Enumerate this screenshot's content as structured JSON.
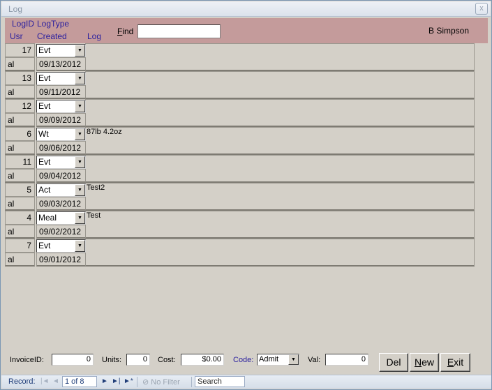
{
  "window": {
    "title": "Log",
    "close": "x"
  },
  "header": {
    "col_logid": "LogID",
    "col_logtype": "LogType",
    "col_usr": "Usr",
    "col_created": "Created",
    "col_log": "Log",
    "find_label_accel": "F",
    "find_label_rest": "ind",
    "find_value": "",
    "user_name": "B Simpson"
  },
  "records": [
    {
      "id": "17",
      "type": "Evt",
      "log": "",
      "usr": "al",
      "created": "09/13/2012"
    },
    {
      "id": "13",
      "type": "Evt",
      "log": "",
      "usr": "al",
      "created": "09/11/2012"
    },
    {
      "id": "12",
      "type": "Evt",
      "log": "",
      "usr": "al",
      "created": "09/09/2012"
    },
    {
      "id": "6",
      "type": "Wt",
      "log": "87lb 4.2oz",
      "usr": "al",
      "created": "09/06/2012"
    },
    {
      "id": "11",
      "type": "Evt",
      "log": "",
      "usr": "al",
      "created": "09/04/2012"
    },
    {
      "id": "5",
      "type": "Act",
      "log": "Test2",
      "usr": "al",
      "created": "09/03/2012"
    },
    {
      "id": "4",
      "type": "Meal",
      "log": "Test",
      "usr": "al",
      "created": "09/02/2012"
    },
    {
      "id": "7",
      "type": "Evt",
      "log": "",
      "usr": "al",
      "created": "09/01/2012"
    }
  ],
  "footer": {
    "invoice_label": "InvoiceID:",
    "invoice_value": "0",
    "units_label": "Units:",
    "units_value": "0",
    "cost_label": "Cost:",
    "cost_value": "$0.00",
    "code_label": "Code:",
    "code_value": "Admit",
    "val_label": "Val:",
    "val_value": "0",
    "del_label": "Del",
    "new_accel": "N",
    "new_rest": "ew",
    "exit_accel": "E",
    "exit_rest": "xit"
  },
  "statusbar": {
    "record_label": "Record:",
    "record_position": "1 of 8",
    "filter_label": "No Filter",
    "search_label": "Search"
  },
  "icons": {
    "dropdown": "dropdown-arrow-icon",
    "first": "first-record-icon",
    "prev": "previous-record-icon",
    "next": "next-record-icon",
    "last": "last-record-icon",
    "new": "new-record-icon",
    "filter": "filter-icon"
  },
  "colors": {
    "header_bg": "#c49b9b",
    "header_label": "#2a1f9e",
    "form_bg": "#d4d0c8"
  }
}
